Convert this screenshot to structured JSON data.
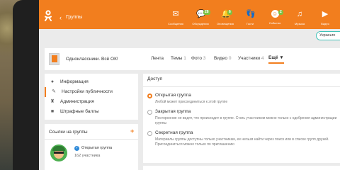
{
  "header": {
    "back_glyph": "‹",
    "title": "Группы",
    "nav": [
      {
        "label": "Сообщения",
        "icon": "envelope-icon",
        "badge": ""
      },
      {
        "label": "Обсуждения",
        "icon": "discussions-icon",
        "badge": "28"
      },
      {
        "label": "Оповещения",
        "icon": "bell-icon",
        "badge": "6"
      },
      {
        "label": "Гости",
        "icon": "footprints-icon",
        "badge": ""
      },
      {
        "label": "События",
        "icon": "events-icon",
        "badge": "2"
      },
      {
        "label": "Музыка",
        "icon": "music-note-icon",
        "badge": ""
      },
      {
        "label": "Видео",
        "icon": "video-icon",
        "badge": ""
      }
    ]
  },
  "decorate_button": "Украсьте",
  "group_bar": {
    "name": "Одноклассники. Всё ОК!",
    "tabs": [
      {
        "label": "Лента",
        "count": ""
      },
      {
        "label": "Темы",
        "count": "1"
      },
      {
        "label": "Фото",
        "count": "3"
      },
      {
        "label": "Видео",
        "count": "0"
      },
      {
        "label": "Участники",
        "count": "4"
      },
      {
        "label": "Ещё ▼",
        "count": ""
      }
    ]
  },
  "side_menu": [
    {
      "label": "Информация",
      "icon": "info-icon"
    },
    {
      "label": "Настройки публичности",
      "icon": "pencil-icon"
    },
    {
      "label": "Администрация",
      "icon": "shield-icon"
    },
    {
      "label": "Штрафные баллы",
      "icon": "penalty-icon"
    }
  ],
  "links_card": {
    "title": "Ссылки на группы",
    "add": "+",
    "item": {
      "type": "Открытая группа",
      "count": "162 участника"
    }
  },
  "access": {
    "title": "Доступ",
    "options": [
      {
        "label": "Открытая группа",
        "desc": "Любой может присоединиться к этой группе",
        "selected": true
      },
      {
        "label": "Закрытая группа",
        "desc": "Посторонние не видят, что происходит в группе. Стать участником можно только с одобрения администрации группы",
        "selected": false
      },
      {
        "label": "Секретная группа",
        "desc": "Материалы группы доступны только участникам, ее нельзя найти через поиск или в списке групп друзей. Присоединиться можно только по приглашению",
        "selected": false
      }
    ]
  },
  "colors": {
    "accent": "#f27e1e",
    "badge": "#7cc242",
    "focus": "#3ec2b7"
  }
}
